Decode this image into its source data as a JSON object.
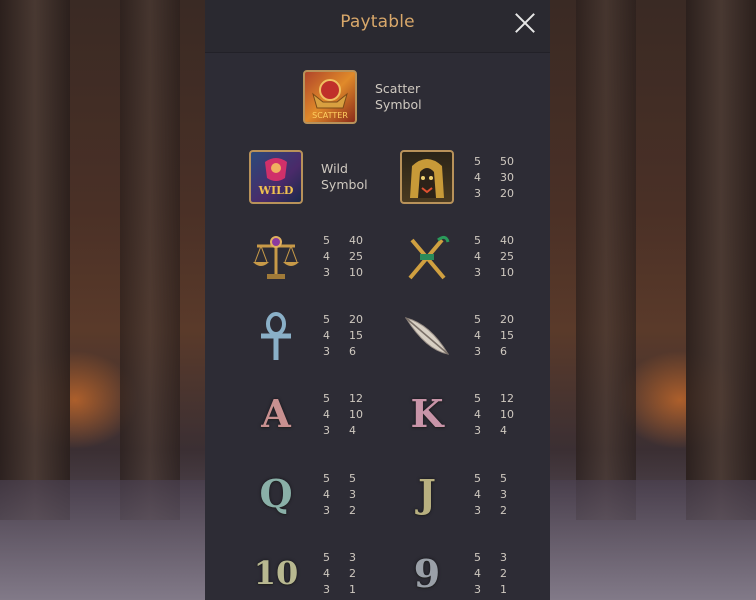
{
  "header": {
    "title": "Paytable"
  },
  "scatter": {
    "badge": "SCATTER",
    "label_line1": "Scatter",
    "label_line2": "Symbol"
  },
  "wild": {
    "badge": "WILD",
    "label_line1": "Wild",
    "label_line2": "Symbol"
  },
  "symbols": [
    {
      "icon": "pharaoh-icon",
      "pays": [
        [
          "5",
          "50"
        ],
        [
          "4",
          "30"
        ],
        [
          "3",
          "20"
        ]
      ]
    },
    {
      "icon": "scales-icon",
      "pays": [
        [
          "5",
          "40"
        ],
        [
          "4",
          "25"
        ],
        [
          "3",
          "10"
        ]
      ]
    },
    {
      "icon": "crook-flail-icon",
      "pays": [
        [
          "5",
          "40"
        ],
        [
          "4",
          "25"
        ],
        [
          "3",
          "10"
        ]
      ]
    },
    {
      "icon": "ankh-icon",
      "pays": [
        [
          "5",
          "20"
        ],
        [
          "4",
          "15"
        ],
        [
          "3",
          "6"
        ]
      ]
    },
    {
      "icon": "feather-icon",
      "pays": [
        [
          "5",
          "20"
        ],
        [
          "4",
          "15"
        ],
        [
          "3",
          "6"
        ]
      ]
    },
    {
      "icon": "letter-a-icon",
      "glyph": "A",
      "pays": [
        [
          "5",
          "12"
        ],
        [
          "4",
          "10"
        ],
        [
          "3",
          "4"
        ]
      ]
    },
    {
      "icon": "letter-k-icon",
      "glyph": "K",
      "pays": [
        [
          "5",
          "12"
        ],
        [
          "4",
          "10"
        ],
        [
          "3",
          "4"
        ]
      ]
    },
    {
      "icon": "letter-q-icon",
      "glyph": "Q",
      "pays": [
        [
          "5",
          "5"
        ],
        [
          "4",
          "3"
        ],
        [
          "3",
          "2"
        ]
      ]
    },
    {
      "icon": "letter-j-icon",
      "glyph": "J",
      "pays": [
        [
          "5",
          "5"
        ],
        [
          "4",
          "3"
        ],
        [
          "3",
          "2"
        ]
      ]
    },
    {
      "icon": "number-10-icon",
      "glyph": "10",
      "pays": [
        [
          "5",
          "3"
        ],
        [
          "4",
          "2"
        ],
        [
          "3",
          "1"
        ]
      ]
    },
    {
      "icon": "number-9-icon",
      "glyph": "9",
      "pays": [
        [
          "5",
          "3"
        ],
        [
          "4",
          "2"
        ],
        [
          "3",
          "1"
        ]
      ]
    }
  ],
  "colors": {
    "title": "#d9a86a",
    "panel": "#2d2c35",
    "text": "#cfc9c0"
  }
}
